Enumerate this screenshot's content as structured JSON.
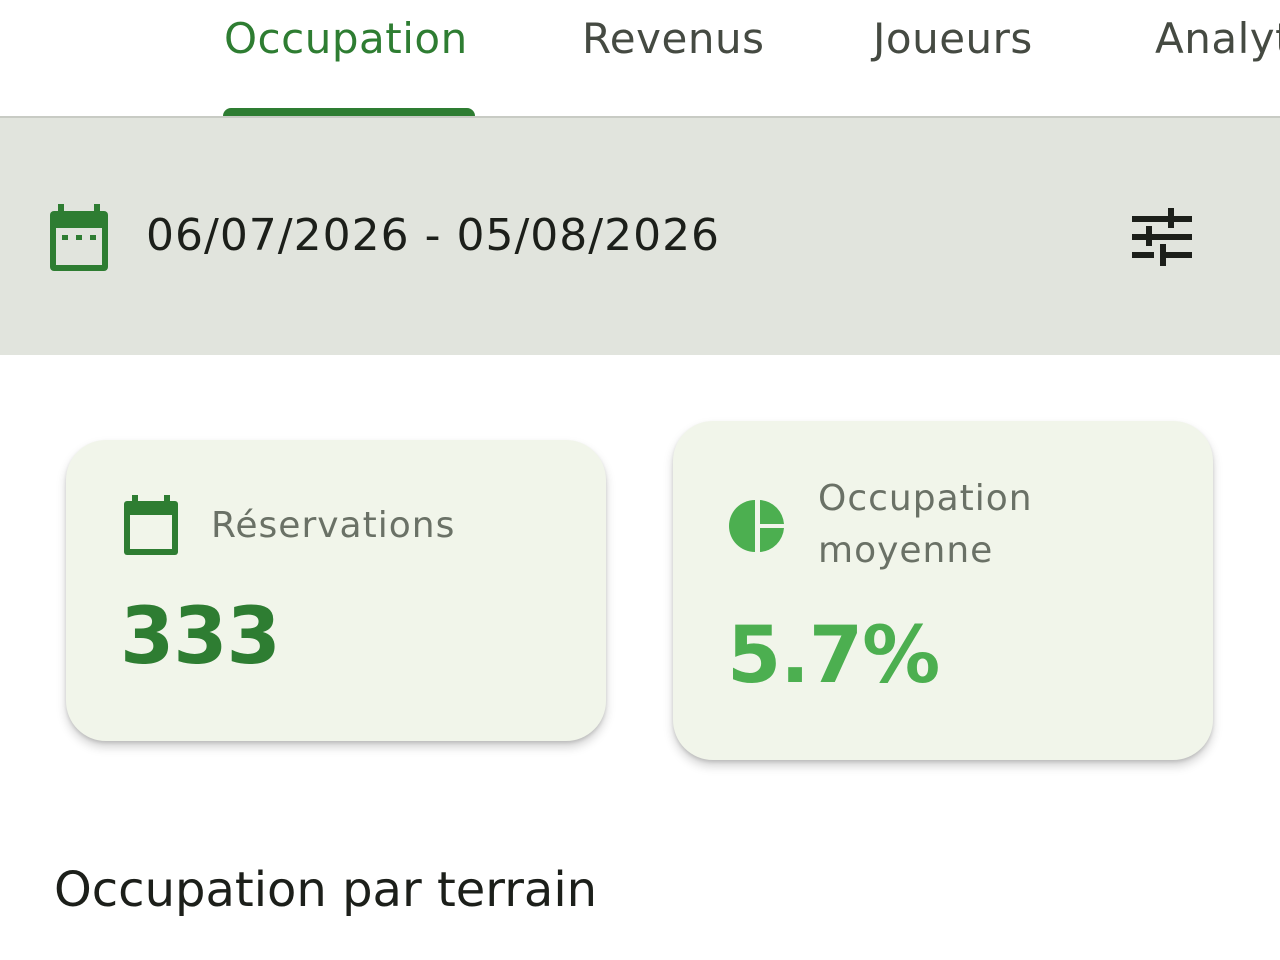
{
  "tabs": [
    {
      "label": "Occupation",
      "active": true
    },
    {
      "label": "Revenus",
      "active": false
    },
    {
      "label": "Joueurs",
      "active": false
    },
    {
      "label": "Analyt",
      "active": false
    }
  ],
  "filter_bar": {
    "date_range": "06/07/2026 - 05/08/2026",
    "calendar_icon": "calendar-icon",
    "filter_icon": "tune-icon"
  },
  "stats": {
    "reservations": {
      "label": "Réservations",
      "value": "333",
      "icon": "calendar-icon",
      "value_color": "#2e7d32"
    },
    "occupation": {
      "label_line1": "Occupation",
      "label_line2": "moyenne",
      "value": "5.7%",
      "icon": "pie-chart-icon",
      "value_color": "#4caf50"
    }
  },
  "section": {
    "title": "Occupation par terrain"
  },
  "colors": {
    "primary": "#2e7d32",
    "accent": "#4caf50",
    "bar_background": "#e1e4dd",
    "card_background": "#f1f5ea"
  }
}
